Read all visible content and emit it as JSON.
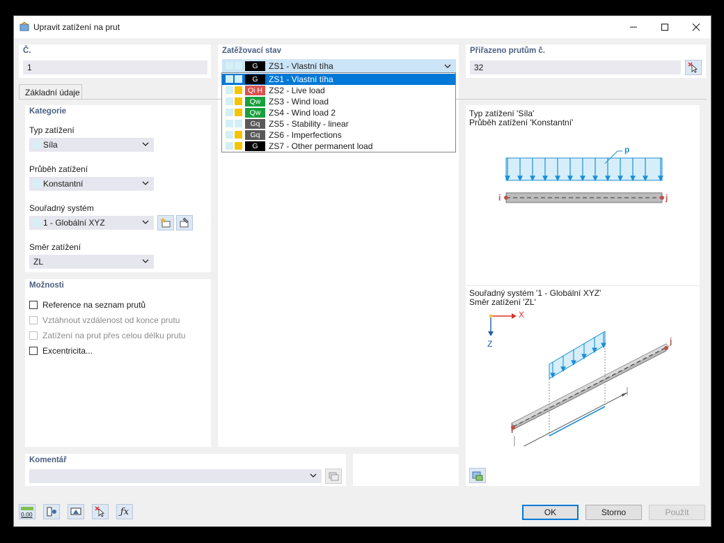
{
  "window": {
    "title": "Upravit zatížení na prut"
  },
  "no": {
    "label": "Č.",
    "value": "1"
  },
  "load_case": {
    "label": "Zatěžovací stav",
    "selected": {
      "sw2": "#d2f0f5",
      "cat": "G",
      "cat_color": "#000000",
      "text": "ZS1 - Vlastní tíha"
    },
    "options": [
      {
        "sw2": "#d2f0f5",
        "cat": "G",
        "cat_color": "#000000",
        "text": "ZS1 - Vlastní tíha",
        "selected": true
      },
      {
        "sw2": "#f5c400",
        "cat": "Qi H",
        "cat_color": "#d9534f",
        "text": "ZS2 - Live load"
      },
      {
        "sw2": "#f5c400",
        "cat": "Qw",
        "cat_color": "#19a03c",
        "text": "ZS3 - Wind load"
      },
      {
        "sw2": "#f5c400",
        "cat": "Qw",
        "cat_color": "#19a03c",
        "text": "ZS4 - Wind load 2"
      },
      {
        "sw2": "#d2f0f5",
        "cat": "Gq",
        "cat_color": "#595959",
        "text": "ZS5 - Stability - linear"
      },
      {
        "sw2": "#f5c400",
        "cat": "Gq",
        "cat_color": "#595959",
        "text": "ZS6 - Imperfections"
      },
      {
        "sw2": "#f5c400",
        "cat": "G",
        "cat_color": "#000000",
        "text": "ZS7 - Other permanent load"
      }
    ]
  },
  "assigned": {
    "label": "Přiřazeno prutům č.",
    "value": "32"
  },
  "tab": {
    "label": "Základní údaje"
  },
  "category": {
    "header": "Kategorie",
    "load_type": {
      "label": "Typ zatížení",
      "value": "Síla"
    },
    "distribution": {
      "label": "Průběh zatížení",
      "value": "Konstantní"
    },
    "coord_system": {
      "label": "Souřadný systém",
      "value": "1 - Globální XYZ"
    },
    "direction": {
      "label": "Směr zatížení",
      "value": "ZL"
    }
  },
  "options": {
    "header": "Možnosti",
    "items": [
      {
        "label": "Reference na seznam prutů",
        "enabled": true
      },
      {
        "label": "Vztáhnout vzdálenost od konce prutu",
        "enabled": false
      },
      {
        "label": "Zatížení na prut přes celou délku prutu",
        "enabled": false
      },
      {
        "label": "Excentricita...",
        "enabled": true
      }
    ]
  },
  "preview": {
    "top_line1": "Typ zatížení 'Síla'",
    "top_line2": "Průběh zatížení 'Konstantní'",
    "label_p": "p",
    "label_i": "i",
    "label_j": "j",
    "bottom_line1": "Souřadný systém '1 - Globální XYZ'",
    "bottom_line2": "Směr zatížení 'ZL'",
    "axis_x": "X",
    "axis_z": "Z"
  },
  "comment": {
    "header": "Komentář",
    "value": ""
  },
  "footer": {
    "ok": "OK",
    "cancel": "Storno",
    "apply": "Použít",
    "units_icon_text": "0,00"
  },
  "colors": {
    "accent": "#0078d7",
    "load_blue": "#1a8fd6",
    "load_fill": "#d6eefa",
    "header_text": "#4c5f82"
  }
}
